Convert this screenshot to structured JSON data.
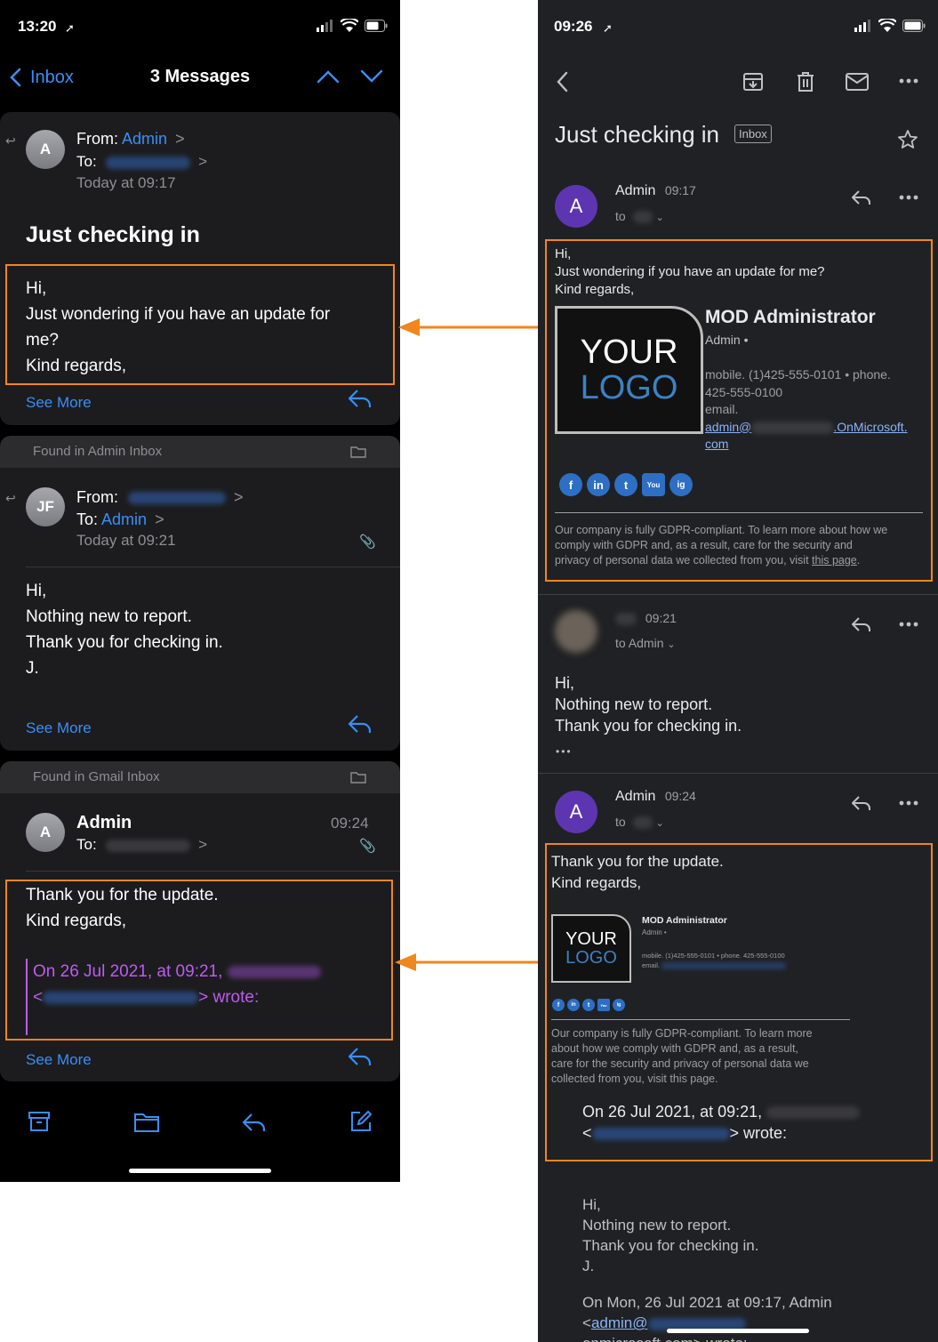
{
  "left_phone": {
    "status": {
      "time": "13:20"
    },
    "nav": {
      "back_label": "Inbox",
      "title": "3 Messages"
    },
    "message1": {
      "avatar": "A",
      "from_label": "From:",
      "from_name": "Admin",
      "to_label": "To:",
      "date": "Today at 09:17",
      "subject": "Just checking in",
      "body": [
        "Hi,",
        "Just wondering if you have an update for",
        "me?",
        "Kind regards,"
      ],
      "see_more": "See More"
    },
    "found1": {
      "label": "Found in Admin Inbox"
    },
    "message2": {
      "avatar": "JF",
      "from_label": "From:",
      "to_label": "To:",
      "to_name": "Admin",
      "date": "Today at 09:21",
      "body": [
        "Hi,",
        "Nothing new to report.",
        "Thank you for checking in.",
        "J."
      ],
      "see_more": "See More"
    },
    "found2": {
      "label": "Found in Gmail Inbox"
    },
    "message3": {
      "avatar": "A",
      "from_name": "Admin",
      "time": "09:24",
      "to_label": "To:",
      "body": [
        "Thank you for the update.",
        "Kind regards,"
      ],
      "quote_line1": "On 26 Jul 2021, at 09:21,",
      "quote_lt": "<",
      "quote_wrote": "> wrote:",
      "see_more": "See More"
    }
  },
  "right_phone": {
    "status": {
      "time": "09:26"
    },
    "subject": "Just checking in",
    "label_badge": "Inbox",
    "message1": {
      "avatar": "A",
      "sender": "Admin",
      "time": "09:17",
      "to_label": "to",
      "body": [
        "Hi,",
        "Just wondering if you have an update for me?",
        "Kind regards,"
      ],
      "sig_name": "MOD Administrator",
      "sig_role": "Admin •",
      "sig_phones": "mobile. (1)425-555-0101 • phone.",
      "sig_phone2": "425-555-0100",
      "sig_email_label": "email.",
      "sig_email_start": "admin@",
      "sig_email_end": ".OnMicrosoft.",
      "sig_email_tail": "com",
      "gdpr": [
        "Our company is fully GDPR-compliant. To learn more about how we",
        "comply with GDPR and, as a result, care for the security and",
        "privacy of personal data we collected from you, visit"
      ],
      "gdpr_link": "this page",
      "gdpr_end": "."
    },
    "logo": {
      "line1": "YOUR",
      "line2": "LOGO"
    },
    "social_icons": [
      "f",
      "in",
      "t",
      "You",
      "ig"
    ],
    "message2": {
      "time": "09:21",
      "to_label": "to Admin",
      "body": [
        "Hi,",
        "Nothing new to report.",
        "Thank you for checking in."
      ],
      "ellipsis": "•••"
    },
    "message3": {
      "avatar": "A",
      "sender": "Admin",
      "time": "09:24",
      "to_label": "to",
      "body": [
        "Thank you for the update.",
        "Kind regards,"
      ],
      "sig_name": "MOD Administrator",
      "sig_role": "Admin •",
      "sig_phones": "mobile. (1)425-555-0101 • phone. 425-555-0100",
      "sig_email_label": "email.",
      "gdpr": [
        "Our company is fully GDPR-compliant. To learn more",
        "about how we comply with GDPR and, as a result,",
        "care for the security and privacy of personal data we",
        "collected from you, visit this page."
      ],
      "quote_line1": "On 26 Jul 2021, at 09:21,",
      "quote_lt": "<",
      "quote_wrote": "> wrote:",
      "quoted_body": [
        "Hi,",
        "Nothing new to report.",
        "Thank you for checking in.",
        "J."
      ],
      "quote2_line1": "On Mon, 26 Jul 2021 at 09:17, Admin",
      "quote2_line2_start": "<",
      "quote2_email": "admin@",
      "quote2_line3": "onmicrosoft.com> wrote:"
    }
  },
  "colors": {
    "highlight": "#f0861e",
    "ios_blue": "#3a8ef6",
    "quote_purple": "#bf5af2",
    "gmail_avatar": "#5e35b1",
    "logo_blue": "#3b82c4"
  }
}
